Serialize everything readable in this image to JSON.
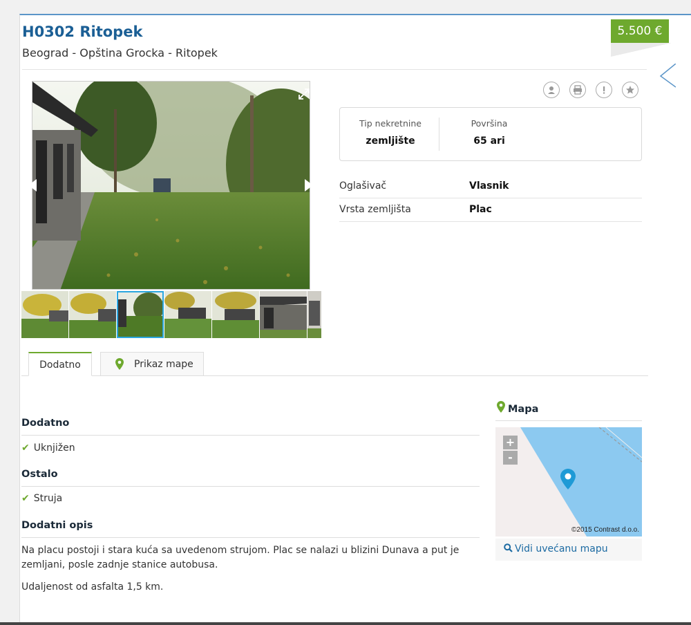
{
  "listing": {
    "title": "H0302 Ritopek",
    "location": "Beograd - Opština Grocka - Ritopek",
    "price": "5.500 €"
  },
  "properties": [
    {
      "label": "Tip nekretnine",
      "value": "zemljište"
    },
    {
      "label": "Površina",
      "value": "65 ari"
    }
  ],
  "details": [
    {
      "key": "Oglašivač",
      "value": "Vlasnik"
    },
    {
      "key": "Vrsta zemljišta",
      "value": "Plac"
    }
  ],
  "actions": [
    "contact-icon",
    "print-icon",
    "report-icon",
    "favorite-icon"
  ],
  "gallery": {
    "thumb_count": 7,
    "active_thumb": 3
  },
  "tabs": {
    "dodatno": "Dodatno",
    "mapa": "Prikaz mape"
  },
  "sections": {
    "dodatno": {
      "title": "Dodatno",
      "items": [
        "Uknjižen"
      ]
    },
    "ostalo": {
      "title": "Ostalo",
      "items": [
        "Struja"
      ]
    },
    "opis": {
      "title": "Dodatni opis",
      "paragraph1": "Na placu postoji i stara kuća sa uvedenom strujom. Plac se nalazi u blizini Dunava a put je zemljani, posle zadnje stanice autobusa.",
      "paragraph2": "Udaljenost od asfalta 1,5 km."
    }
  },
  "map": {
    "title": "Mapa",
    "zoom_in": "+",
    "zoom_out": "-",
    "credit": "©2015 Contrast d.o.o.",
    "link": "Vidi uvećanu mapu"
  },
  "colors": {
    "accent_green": "#6ea92e",
    "title_blue": "#1b5f95",
    "water": "#8cc9f0",
    "pin": "#1e9ad6"
  }
}
